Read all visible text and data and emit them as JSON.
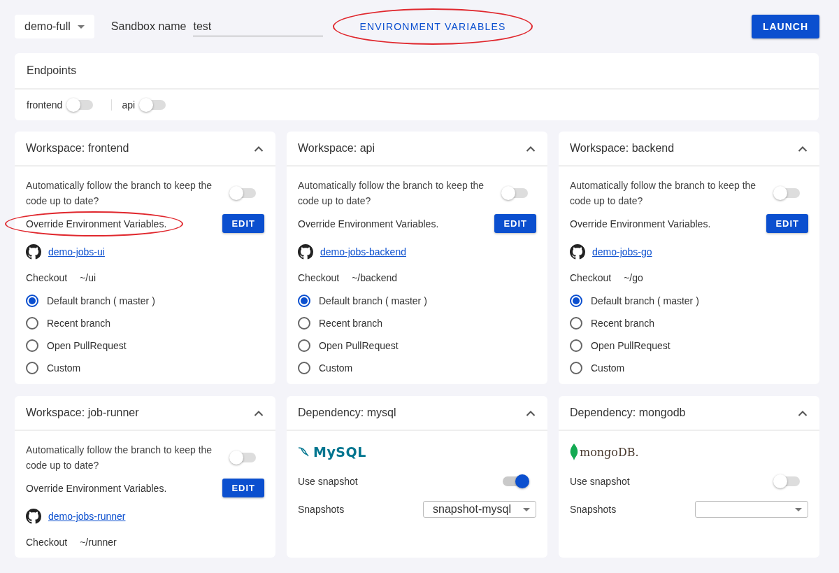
{
  "toolbar": {
    "sandbox_select": "demo-full",
    "sandbox_name_label": "Sandbox name",
    "sandbox_name_value": "test",
    "env_button": {
      "label": "ENVIRONMENT VARIABLES",
      "highlighted": true
    },
    "launch_button": "LAUNCH"
  },
  "endpoints": {
    "title": "Endpoints",
    "items": [
      {
        "label": "frontend",
        "on": false
      },
      {
        "label": "api",
        "on": false
      }
    ]
  },
  "cards": [
    {
      "kind": "workspace",
      "title": "Workspace: frontend",
      "expanded": true,
      "follow_label": "Automatically follow the branch to keep the code up to date?",
      "follow_on": false,
      "override_label": "Override Environment Variables.",
      "edit_button": "EDIT",
      "highlighted": true,
      "repo": "demo-jobs-ui",
      "checkout_label": "Checkout",
      "checkout_path": "~/ui",
      "branches": [
        {
          "label": "Default branch ( master )",
          "selected": true
        },
        {
          "label": "Recent branch",
          "selected": false
        },
        {
          "label": "Open PullRequest",
          "selected": false
        },
        {
          "label": "Custom",
          "selected": false
        }
      ]
    },
    {
      "kind": "workspace",
      "title": "Workspace: api",
      "expanded": true,
      "follow_label": "Automatically follow the branch to keep the code up to date?",
      "follow_on": false,
      "override_label": "Override Environment Variables.",
      "edit_button": "EDIT",
      "highlighted": false,
      "repo": "demo-jobs-backend",
      "checkout_label": "Checkout",
      "checkout_path": "~/backend",
      "branches": [
        {
          "label": "Default branch ( master )",
          "selected": true
        },
        {
          "label": "Recent branch",
          "selected": false
        },
        {
          "label": "Open PullRequest",
          "selected": false
        },
        {
          "label": "Custom",
          "selected": false
        }
      ]
    },
    {
      "kind": "workspace",
      "title": "Workspace: backend",
      "expanded": true,
      "follow_label": "Automatically follow the branch to keep the code up to date?",
      "follow_on": false,
      "override_label": "Override Environment Variables.",
      "edit_button": "EDIT",
      "highlighted": false,
      "repo": "demo-jobs-go",
      "checkout_label": "Checkout",
      "checkout_path": "~/go",
      "branches": [
        {
          "label": "Default branch ( master )",
          "selected": true
        },
        {
          "label": "Recent branch",
          "selected": false
        },
        {
          "label": "Open PullRequest",
          "selected": false
        },
        {
          "label": "Custom",
          "selected": false
        }
      ]
    },
    {
      "kind": "workspace",
      "title": "Workspace: job-runner",
      "expanded": true,
      "follow_label": "Automatically follow the branch to keep the code up to date?",
      "follow_on": false,
      "override_label": "Override Environment Variables.",
      "edit_button": "EDIT",
      "highlighted": false,
      "repo": "demo-jobs-runner",
      "checkout_label": "Checkout",
      "checkout_path": "~/runner"
    },
    {
      "kind": "dependency",
      "title": "Dependency: mysql",
      "expanded": true,
      "logo": {
        "kind": "mysql",
        "text": "MySQL"
      },
      "snapshot_label": "Use snapshot",
      "snapshot_on": true,
      "snapshots_label": "Snapshots",
      "snapshot_value": "snapshot-mysql"
    },
    {
      "kind": "dependency",
      "title": "Dependency: mongodb",
      "expanded": true,
      "logo": {
        "kind": "mongodb",
        "text": "mongoDB."
      },
      "snapshot_label": "Use snapshot",
      "snapshot_on": false,
      "snapshots_label": "Snapshots"
    }
  ]
}
